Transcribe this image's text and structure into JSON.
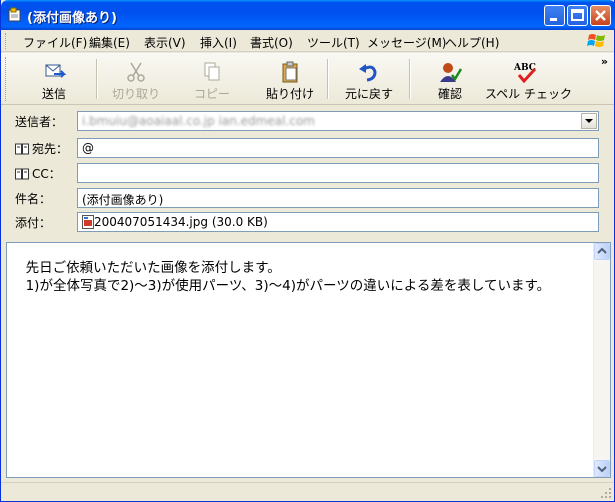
{
  "window": {
    "title": "(添付画像あり)"
  },
  "menu": {
    "items": [
      "ファイル(F)",
      "編集(E)",
      "表示(V)",
      "挿入(I)",
      "書式(O)",
      "ツール(T)",
      "メッセージ(M)",
      "ヘルプ(H)"
    ]
  },
  "toolbar": {
    "send": "送信",
    "cut": "切り取り",
    "copy": "コピー",
    "paste": "貼り付け",
    "undo": "元に戻す",
    "check": "確認",
    "spell": "スペル チェック",
    "spell_badge": "ABC",
    "more": "»"
  },
  "header": {
    "from_label": "送信者：",
    "from_value": "i.bmuiu@aoaiaal.co.jp     ian.edmeal.com",
    "to_label": "宛先：",
    "to_value": "@",
    "cc_label": "CC：",
    "cc_value": "",
    "subject_label": "件名：",
    "subject_value": "(添付画像あり)",
    "attach_label": "添付：",
    "attach_value": "200407051434.jpg (30.0 KB)"
  },
  "body": {
    "text": "  先日ご依頼いただいた画像を添付します。\n  1)が全体写真で2)～3)が使用パーツ、3)～4)がパーツの違いによる差を表しています。"
  },
  "colors": {
    "titlebar": "#0053ee",
    "chrome": "#ece9d8",
    "field_border": "#7f9db9"
  }
}
